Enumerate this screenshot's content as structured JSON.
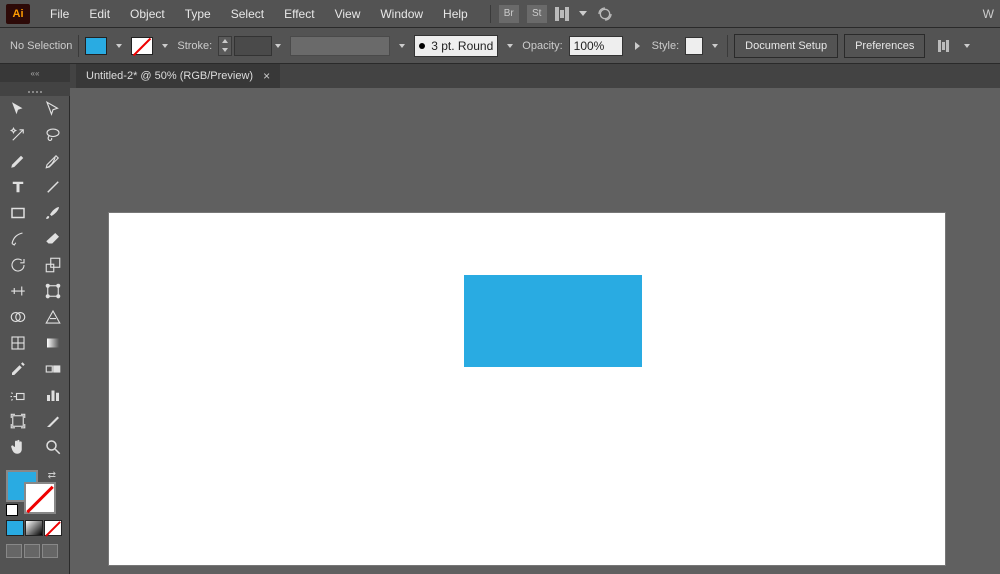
{
  "app": {
    "logo": "Ai",
    "right_indicator": "W"
  },
  "menu": {
    "items": [
      "File",
      "Edit",
      "Object",
      "Type",
      "Select",
      "Effect",
      "View",
      "Window",
      "Help"
    ]
  },
  "menubar_icons": {
    "br": "Br",
    "st": "St"
  },
  "controlbar": {
    "selection_label": "No Selection",
    "stroke_label": "Stroke:",
    "brush_preset": "3 pt. Round",
    "opacity_label": "Opacity:",
    "opacity_value": "100%",
    "style_label": "Style:",
    "doc_setup": "Document Setup",
    "prefs": "Preferences"
  },
  "tab": {
    "title": "Untitled-2* @ 50% (RGB/Preview)"
  },
  "colors": {
    "fill": "#29abe2",
    "stroke": "none"
  },
  "canvas": {
    "rect_color": "#29abe2"
  },
  "tools": [
    [
      "selection-tool",
      "direct-selection-tool"
    ],
    [
      "magic-wand-tool",
      "lasso-tool"
    ],
    [
      "pen-tool",
      "curvature-tool"
    ],
    [
      "type-tool",
      "line-segment-tool"
    ],
    [
      "rectangle-tool",
      "paintbrush-tool"
    ],
    [
      "shaper-tool",
      "eraser-tool"
    ],
    [
      "rotate-tool",
      "scale-tool"
    ],
    [
      "width-tool",
      "free-transform-tool"
    ],
    [
      "shape-builder-tool",
      "perspective-grid-tool"
    ],
    [
      "mesh-tool",
      "gradient-tool"
    ],
    [
      "eyedropper-tool",
      "blend-tool"
    ],
    [
      "symbol-sprayer-tool",
      "column-graph-tool"
    ],
    [
      "artboard-tool",
      "slice-tool"
    ],
    [
      "hand-tool",
      "zoom-tool"
    ]
  ]
}
